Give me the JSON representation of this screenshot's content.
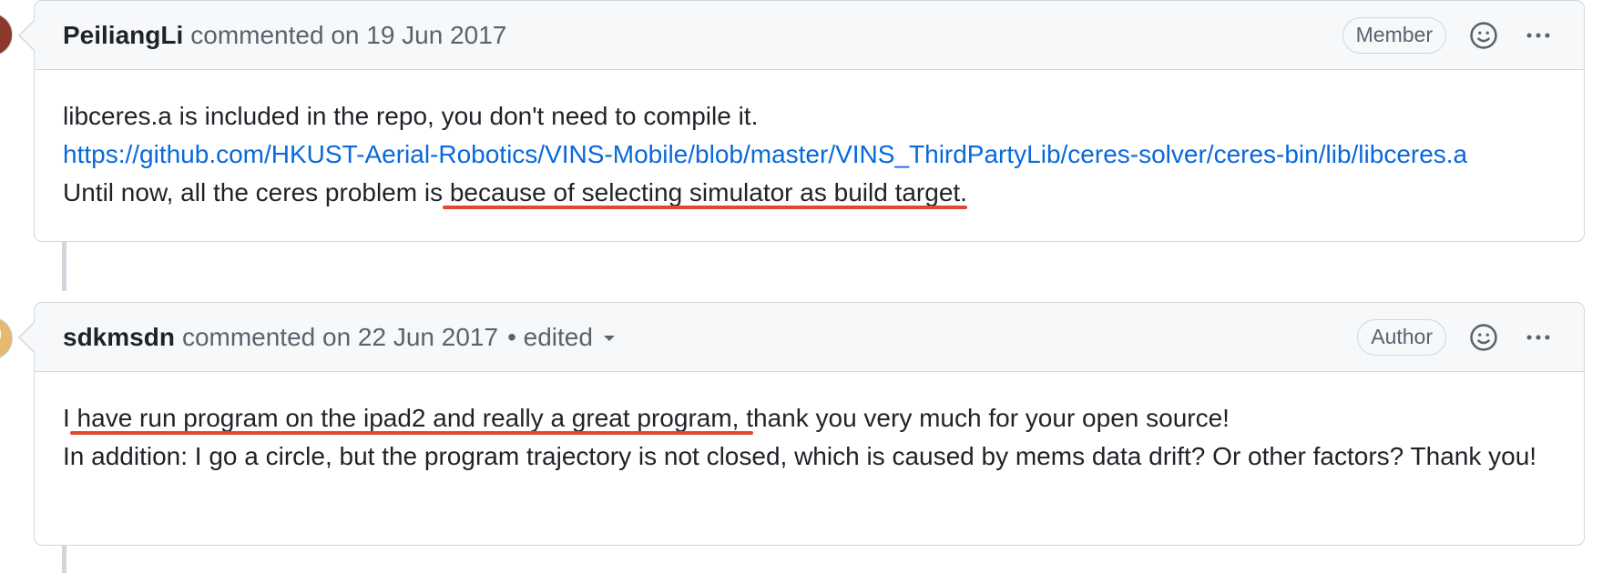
{
  "comments": [
    {
      "author": "PeiliangLi",
      "meta": "commented on 19 Jun 2017",
      "badge": "Member",
      "body": {
        "line1": "libceres.a is included in the repo, you don't need to compile it.",
        "link": "https://github.com/HKUST-Aerial-Robotics/VINS-Mobile/blob/master/VINS_ThirdPartyLib/ceres-solver/ceres-bin/lib/libceres.a",
        "line3_prefix": "Until now, all the ceres problem is",
        "line3_highlight": " because of selecting simulator as build target."
      }
    },
    {
      "author": "sdkmsdn",
      "meta": "commented on 22 Jun 2017",
      "edited": "• edited",
      "badge": "Author",
      "body": {
        "line1_prefix": "I",
        "line1_highlight": " have run program on the ipad2 and really a great program, t",
        "line1_suffix": "hank you very much for your open source!",
        "line2": "In addition: I go a circle, but the program trajectory is not closed, which is caused by mems data drift? Or other factors? Thank you!"
      }
    }
  ],
  "icons": {
    "reaction": "smiley-icon",
    "more": "kebab-horizontal-icon"
  },
  "colors": {
    "highlight": "#e4472c",
    "link": "#0969da",
    "border": "#d0d7de",
    "header_bg": "#f6f8fa"
  }
}
